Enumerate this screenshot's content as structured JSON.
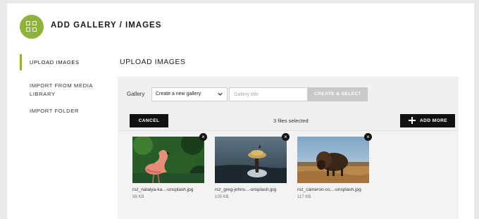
{
  "header": {
    "title": "ADD GALLERY / IMAGES",
    "logo_icon": "gallery-grid-icon",
    "accent_color": "#8db33a"
  },
  "sidebar": {
    "items": [
      {
        "label": "UPLOAD IMAGES",
        "active": true
      },
      {
        "label_line1": "IMPORT FROM MEDIA",
        "label_line2": "LIBRARY",
        "active": false
      },
      {
        "label": "IMPORT FOLDER",
        "active": false
      }
    ]
  },
  "main": {
    "title": "UPLOAD IMAGES",
    "form": {
      "gallery_label": "Gallery",
      "gallery_select_value": "Create a new gallery",
      "gallery_title_placeholder": "Gallery title",
      "create_button": "CREATE & SELECT"
    },
    "toolbar": {
      "cancel_button": "CANCEL",
      "files_selected": "3 files selected",
      "add_more_button": "ADD MORE"
    },
    "files": [
      {
        "name": "rsz_natalya-ka...-unsplash.jpg",
        "size": "98 KB",
        "subject": "flamingo"
      },
      {
        "name": "rsz_greg-johns...-unsplash.jpg",
        "size": "105 KB",
        "subject": "tree"
      },
      {
        "name": "rsz_cameron-co...-unsplash.jpg",
        "size": "117 KB",
        "subject": "bison"
      }
    ]
  }
}
